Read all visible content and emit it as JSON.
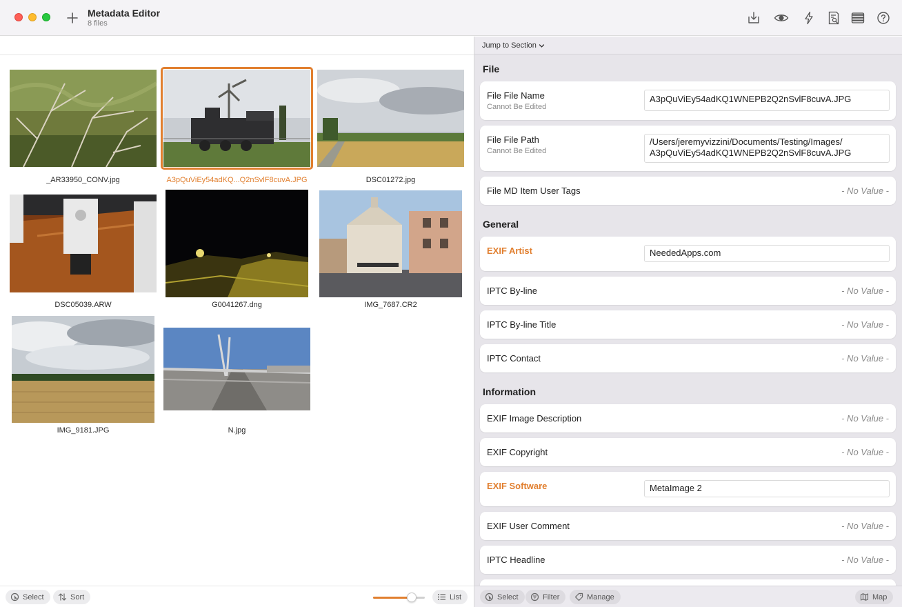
{
  "window": {
    "title": "Metadata Editor",
    "subtitle": "8 files"
  },
  "toolbar": {
    "icons": [
      "export-icon",
      "preview-eye-icon",
      "lightning-icon",
      "inspect-document-icon",
      "columns-icon",
      "help-icon"
    ]
  },
  "grid": {
    "items": [
      {
        "name": "_AR33950_CONV.jpg",
        "selected": false
      },
      {
        "name": "A3pQuViEy54adKQ...Q2nSvlF8cuvA.JPG",
        "selected": true
      },
      {
        "name": "DSC01272.jpg",
        "selected": false
      },
      {
        "name": "DSC05039.ARW",
        "selected": false
      },
      {
        "name": "G0041267.dng",
        "selected": false
      },
      {
        "name": "IMG_7687.CR2",
        "selected": false
      },
      {
        "name": "IMG_9181.JPG",
        "selected": false
      },
      {
        "name": "N.jpg",
        "selected": false
      }
    ]
  },
  "left_footer": {
    "select": "Select",
    "sort": "Sort",
    "list": "List",
    "thumbnail_size": 0.75
  },
  "right_header": {
    "jump": "Jump to Section"
  },
  "sections": {
    "file": {
      "title": "File",
      "name_label": "File File Name",
      "name_sub": "Cannot Be Edited",
      "name_value": "A3pQuViEy54adKQ1WNEPB2Q2nSvlF8cuvA.JPG",
      "path_label": "File File Path",
      "path_sub": "Cannot Be Edited",
      "path_line1": "/Users/jeremyvizzini/Documents/Testing/Images/",
      "path_line2": "A3pQuViEy54adKQ1WNEPB2Q2nSvlF8cuvA.JPG",
      "tags_label": "File MD Item User Tags",
      "tags_value": "- No Value -"
    },
    "general": {
      "title": "General",
      "artist_label": "EXIF Artist",
      "artist_value": "NeededApps.com",
      "byline_label": "IPTC By-line",
      "byline_value": "- No Value -",
      "bylinetitle_label": "IPTC By-line Title",
      "bylinetitle_value": "- No Value -",
      "contact_label": "IPTC Contact",
      "contact_value": "- No Value -"
    },
    "information": {
      "title": "Information",
      "desc_label": "EXIF Image Description",
      "desc_value": "- No Value -",
      "copyright_label": "EXIF Copyright",
      "copyright_value": "- No Value -",
      "software_label": "EXIF Software",
      "software_value": "MetaImage 2",
      "comment_label": "EXIF User Comment",
      "comment_value": "- No Value -",
      "headline_label": "IPTC Headline",
      "headline_value": "- No Value -"
    }
  },
  "right_footer": {
    "select": "Select",
    "filter": "Filter",
    "manage": "Manage",
    "map": "Map"
  },
  "colors": {
    "accent": "#e17f2f",
    "sidebar_bg": "#e7e5ea"
  }
}
